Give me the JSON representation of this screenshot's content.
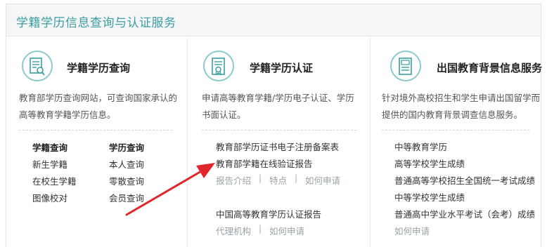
{
  "header": {
    "title": "学籍学历信息查询与认证服务"
  },
  "col1": {
    "title": "学籍学历查询",
    "desc_line1": "教育部学历查询网站，可查询国家承认的",
    "desc_line2": "高等教育学籍学历信息。",
    "left_head": "学籍查询",
    "left_items": [
      "新生学籍",
      "在校生学籍",
      "图像校对"
    ],
    "right_head": "学历查询",
    "right_items": [
      "本人查询",
      "零散查询",
      "会员查询"
    ]
  },
  "col2": {
    "title": "学籍学历认证",
    "desc_line1": "申请高等教育学籍/学历电子认证、学历",
    "desc_line2": "书面认证。",
    "item1": "教育部学历证书电子注册备案表",
    "item2": "教育部学籍在线验证报告",
    "sub_links": [
      "报告介绍",
      "特点",
      "如何申请"
    ],
    "item3": "中国高等教育学历认证报告",
    "sub_links2": [
      "代理机构",
      "如何申请"
    ],
    "separator": "|"
  },
  "col3": {
    "title": "出国教育背景信息服务",
    "desc_line1": "针对境外高校招生和学生申请出国留学而",
    "desc_line2": "提供的国内教育背景调查信息服务。",
    "items": [
      "中等教育学历",
      "高等学校学生成绩",
      "普通高等学校招生全国统一考试成绩",
      "中等学校学生成绩",
      "普通高中学业水平考试（会考）成绩"
    ],
    "apply": "如何申请"
  },
  "icons": {
    "col1": "certificate-search-icon",
    "col2": "certificate-verify-icon",
    "col3": "certificate-document-icon"
  },
  "colors": {
    "accent": "#3a9ea3",
    "arrow": "#e0262a"
  }
}
